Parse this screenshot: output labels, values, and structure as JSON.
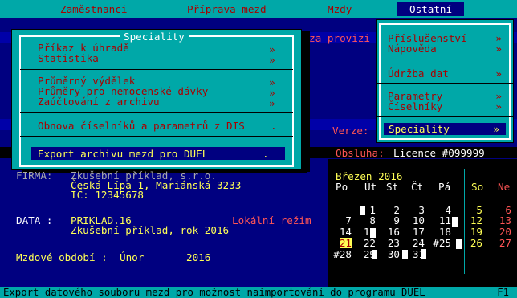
{
  "menu": {
    "items": [
      {
        "label": "Zaměstnanci"
      },
      {
        "label": "Příprava mezd"
      },
      {
        "label": "Mzdy"
      },
      {
        "label": "Ostatní"
      }
    ]
  },
  "background_text": {
    "provizi": "m za provizi",
    "verze": "Verze:",
    "obsluha_label": "Obsluha:",
    "licence": "Licence #099999"
  },
  "ostatni_menu": {
    "items": [
      {
        "label": "Příslušenství",
        "arrow": "»"
      },
      {
        "label": "Nápověda",
        "arrow": "»"
      },
      {
        "label": "Údržba dat",
        "arrow": "»"
      },
      {
        "label": "Parametry",
        "arrow": "»"
      },
      {
        "label": "Číselníky",
        "arrow": "»"
      },
      {
        "label": "Speciality",
        "arrow": "»"
      }
    ]
  },
  "speciality": {
    "title": "Speciality",
    "items": [
      {
        "label": "Příkaz k úhradě",
        "arrow": "»"
      },
      {
        "label": "Statistika",
        "arrow": "»"
      },
      {
        "label": "Průměrný výdělek",
        "arrow": "»"
      },
      {
        "label": "Průměry pro nemocenské dávky",
        "arrow": "»"
      },
      {
        "label": "Zaúčtování z archivu",
        "arrow": "»"
      },
      {
        "label": "Obnova číselníků a parametrů z DIS",
        "arrow": "."
      },
      {
        "label": "Export archivu mezd pro DUEL",
        "arrow": "."
      }
    ]
  },
  "firma": {
    "label": "FIRMA:",
    "name": "Zkušební příklad, s.r.o.",
    "address": "Česká Lípa 1, Mariánská 3233",
    "ic": "IČ: 12345678"
  },
  "data": {
    "label": "DATA :",
    "file": "PRIKLAD.16",
    "mode": "Lokální režim",
    "desc": "Zkušební příklad, rok 2016"
  },
  "obdobi": {
    "label": "Mzdové období :",
    "month": "Únor",
    "year": "2016"
  },
  "calendar": {
    "title": "Březen 2016",
    "days": [
      "Po",
      "Út",
      "St",
      "Čt",
      "Pá",
      "So",
      "Ne"
    ],
    "rows": [
      [
        "",
        "1",
        "2",
        "3",
        "4",
        "5",
        "6"
      ],
      [
        "7",
        "8",
        "9",
        "10",
        "11",
        "12",
        "13"
      ],
      [
        "14",
        "15",
        "16",
        "17",
        "18",
        "19",
        "20"
      ],
      [
        "21",
        "22",
        "23",
        "24",
        "#25",
        "26",
        "27"
      ],
      [
        "#28",
        "29",
        "30",
        "31",
        "",
        "",
        ""
      ]
    ]
  },
  "status": {
    "text": "Export datového souboru mezd pro možnost naimportování do programu DUEL",
    "key": "F1"
  }
}
